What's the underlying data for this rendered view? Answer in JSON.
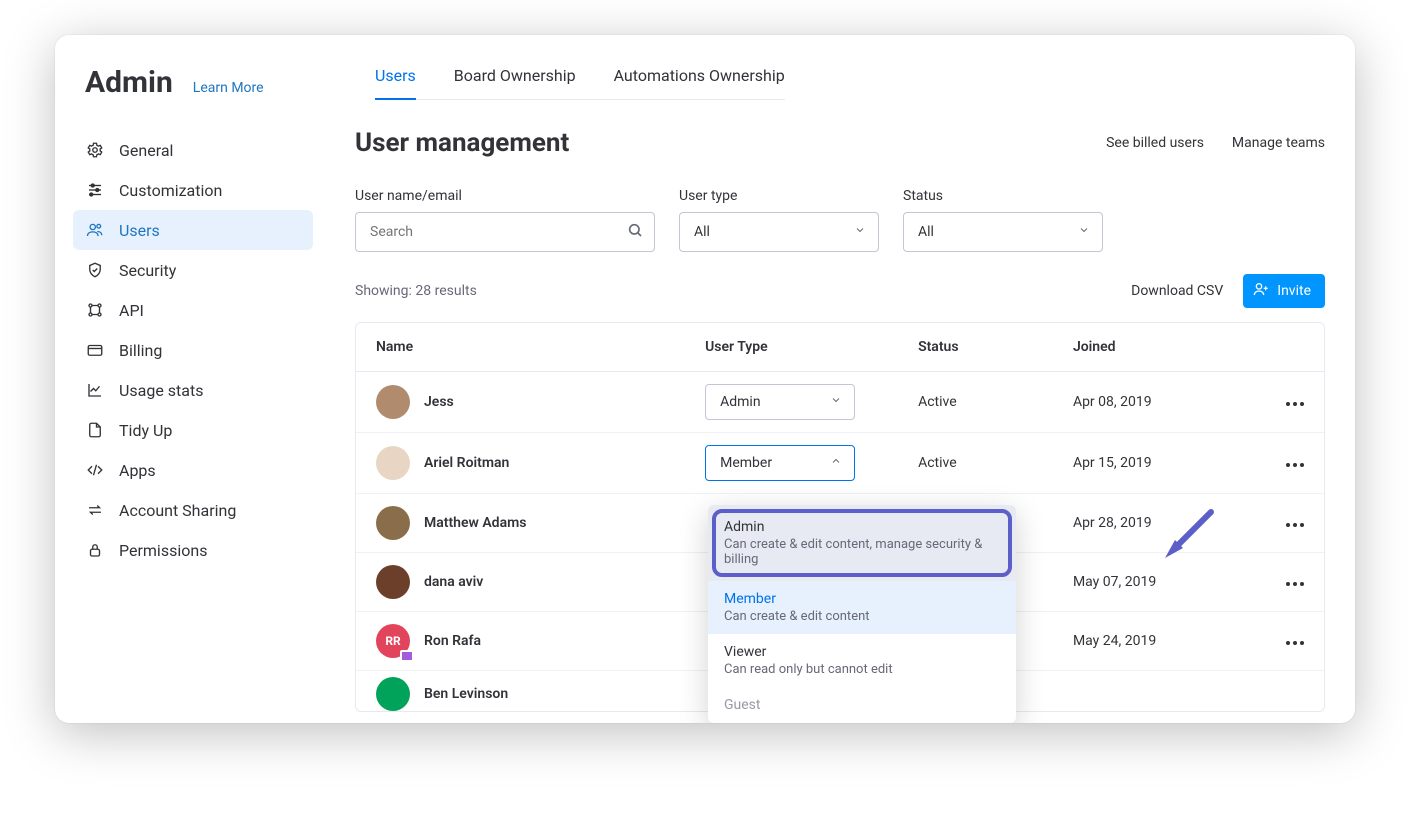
{
  "brand": "Admin",
  "learn_more": "Learn More",
  "tabs": [
    {
      "label": "Users",
      "active": true
    },
    {
      "label": "Board Ownership",
      "active": false
    },
    {
      "label": "Automations Ownership",
      "active": false
    }
  ],
  "sidebar": {
    "items": [
      {
        "label": "General",
        "icon": "gear-icon"
      },
      {
        "label": "Customization",
        "icon": "sliders-icon"
      },
      {
        "label": "Users",
        "icon": "users-icon",
        "active": true
      },
      {
        "label": "Security",
        "icon": "shield-icon"
      },
      {
        "label": "API",
        "icon": "api-icon"
      },
      {
        "label": "Billing",
        "icon": "card-icon"
      },
      {
        "label": "Usage stats",
        "icon": "chart-icon"
      },
      {
        "label": "Tidy Up",
        "icon": "file-icon"
      },
      {
        "label": "Apps",
        "icon": "code-icon"
      },
      {
        "label": "Account Sharing",
        "icon": "swap-icon"
      },
      {
        "label": "Permissions",
        "icon": "lock-icon"
      }
    ]
  },
  "page": {
    "title": "User management",
    "see_billed": "See billed users",
    "manage_teams": "Manage teams"
  },
  "filters": {
    "name_label": "User name/email",
    "name_placeholder": "Search",
    "type_label": "User type",
    "type_value": "All",
    "status_label": "Status",
    "status_value": "All"
  },
  "results": {
    "text": "Showing: 28 results",
    "download": "Download CSV",
    "invite": "Invite"
  },
  "table": {
    "headers": {
      "name": "Name",
      "type": "User Type",
      "status": "Status",
      "joined": "Joined"
    },
    "rows": [
      {
        "name": "Jess",
        "avatar_bg": "#b08b6e",
        "type": "Admin",
        "type_open": false,
        "status": "Active",
        "joined": "Apr 08, 2019"
      },
      {
        "name": "Ariel Roitman",
        "avatar_bg": "#e8d5c4",
        "type": "Member",
        "type_open": true,
        "status": "Active",
        "joined": "Apr 15, 2019"
      },
      {
        "name": "Matthew Adams",
        "avatar_bg": "#8a6d4a",
        "type": "",
        "type_hidden": true,
        "status": "",
        "joined": "Apr 28, 2019"
      },
      {
        "name": "dana aviv",
        "avatar_bg": "#6b3f2a",
        "type": "",
        "type_hidden": true,
        "status": "",
        "joined": "May 07, 2019"
      },
      {
        "name": "Ron Rafa",
        "avatar_bg": "#e2445c",
        "avatar_text": "RR",
        "avatar_badge": true,
        "type": "",
        "type_hidden": true,
        "status": "",
        "joined": "May 24, 2019"
      },
      {
        "name": "Ben Levinson",
        "avatar_bg": "#00a359",
        "type": "",
        "type_hidden": true,
        "status": "",
        "joined": "",
        "cut": true
      }
    ]
  },
  "dropdown": {
    "options": [
      {
        "title": "Admin",
        "desc": "Can create & edit content, manage security & billing",
        "highlight": true
      },
      {
        "title": "Member",
        "desc": "Can create & edit content",
        "current": true
      },
      {
        "title": "Viewer",
        "desc": "Can read only but cannot edit"
      },
      {
        "title": "Guest",
        "desc": "",
        "faded": true
      }
    ]
  }
}
